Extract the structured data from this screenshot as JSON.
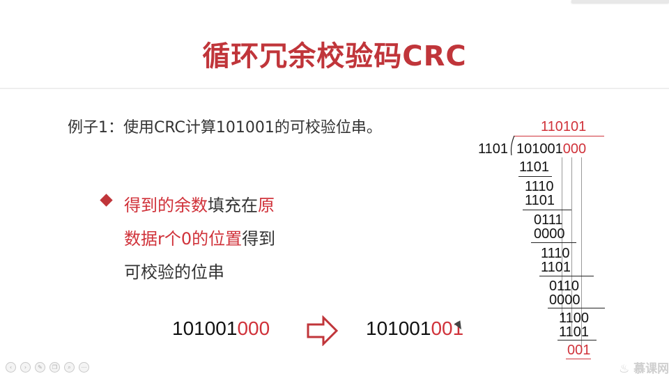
{
  "slide": {
    "title": "循环冗余校验码CRC",
    "example": "例子1：使用CRC计算101001的可校验位串。",
    "bullet": {
      "line1_red": "得到的余数",
      "line1_black": "填充在",
      "line1_red2": "原",
      "line2_red": "数据r个0的位置",
      "line2_black": "得到",
      "line3": "可校验的位串"
    },
    "before": {
      "data": "101001",
      "padding": "000"
    },
    "after": {
      "data": "101001",
      "check": "001"
    }
  },
  "division": {
    "quotient": "110101",
    "divisor": "1101",
    "dividend_data": "101001",
    "dividend_padding": "000",
    "steps": [
      {
        "sub": "1101"
      },
      {
        "partial": "1110",
        "sub": "1101"
      },
      {
        "partial": "0111",
        "sub": "0000"
      },
      {
        "partial": "1110",
        "sub": "1101"
      },
      {
        "partial": "0110",
        "sub": "0000"
      },
      {
        "partial": "1100",
        "sub": "1101"
      }
    ],
    "remainder": "001"
  },
  "branding": {
    "logo": "慕课网",
    "logo_icon": "flame-icon"
  },
  "player_controls": [
    "prev-icon",
    "next-icon",
    "pen-icon",
    "copy-icon",
    "zoom-icon",
    "more-icon"
  ]
}
